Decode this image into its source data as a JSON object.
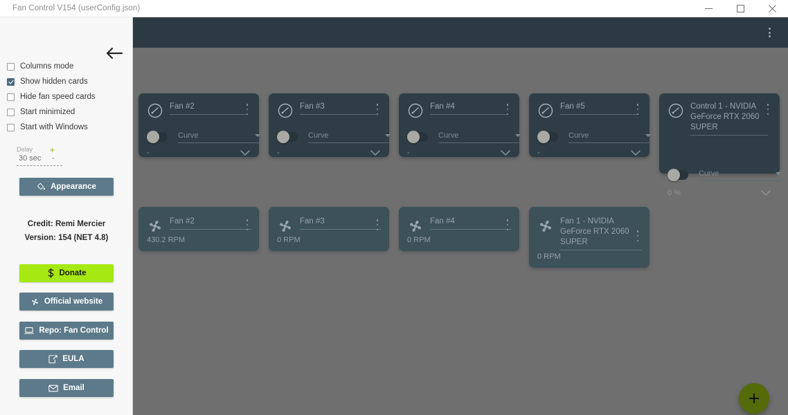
{
  "window": {
    "title": "Fan Control V154 (userConfig.json)",
    "minimize_label": "—",
    "maximize_label": "□",
    "close_label": "×"
  },
  "header": {
    "menu_icon": "kebab-menu-icon"
  },
  "sidebar": {
    "back_icon": "back-arrow-icon",
    "checkboxes": [
      {
        "label": "Columns mode",
        "checked": false
      },
      {
        "label": "Show hidden cards",
        "checked": true
      },
      {
        "label": "Hide fan speed cards",
        "checked": false
      },
      {
        "label": "Start minimized",
        "checked": false
      },
      {
        "label": "Start with Windows",
        "checked": false
      }
    ],
    "delay": {
      "label": "Delay",
      "value": "30 sec",
      "plus": "+",
      "minus": "-"
    },
    "appearance_button": {
      "label": "Appearance",
      "icon": "paint-bucket-icon"
    },
    "credit": "Credit: Remi Mercier",
    "version": "Version: 154 (NET 4.8)",
    "buttons": [
      {
        "label": "Donate",
        "icon": "dollar-icon",
        "color": "#a5e812"
      },
      {
        "label": "Official website",
        "icon": "fan-icon",
        "color": "#5c7a89"
      },
      {
        "label": "Repo: Fan Control",
        "icon": "laptop-icon",
        "color": "#5c7a89"
      },
      {
        "label": "EULA",
        "icon": "document-icon",
        "color": "#5c7a89"
      },
      {
        "label": "Email",
        "icon": "envelope-icon",
        "color": "#5c7a89"
      }
    ]
  },
  "main": {
    "control_cards": [
      {
        "name": "Fan #2",
        "curve": "Curve",
        "value": "-",
        "enabled": false
      },
      {
        "name": "Fan #3",
        "curve": "Curve",
        "value": "-",
        "enabled": false
      },
      {
        "name": "Fan #4",
        "curve": "Curve",
        "value": "-",
        "enabled": false
      },
      {
        "name": "Fan #5",
        "curve": "Curve",
        "value": "-",
        "enabled": false
      },
      {
        "name": "Control 1 - NVIDIA GeForce RTX 2060 SUPER",
        "curve": "Curve",
        "value": "0 %",
        "enabled": false
      }
    ],
    "speed_cards": [
      {
        "name": "Fan #2",
        "rpm": "430.2 RPM"
      },
      {
        "name": "Fan #3",
        "rpm": "0 RPM"
      },
      {
        "name": "Fan #4",
        "rpm": "0 RPM"
      },
      {
        "name": "Fan 1 - NVIDIA GeForce RTX 2060 SUPER",
        "rpm": "0 RPM"
      }
    ],
    "add_button": {
      "label": "+",
      "icon": "plus-icon"
    }
  },
  "colors": {
    "header_bg": "#2c3b43",
    "body_overlay": "#6f6f6f",
    "control_card_bg": "#2f3e46",
    "speed_card_bg": "#3d5159",
    "accent_green": "#a5e812",
    "fab_green": "#556b09",
    "button_blue": "#5c7a89"
  }
}
